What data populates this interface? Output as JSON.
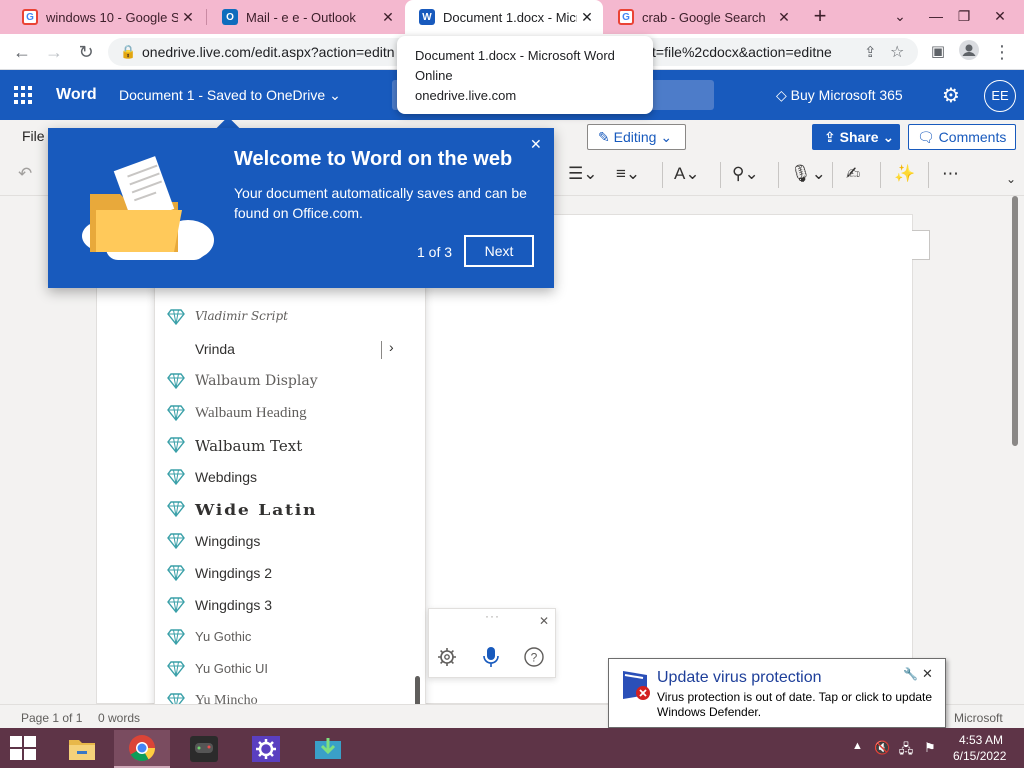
{
  "browser": {
    "tabs": [
      {
        "title": "windows 10 - Google Search",
        "favicon": "google-icon"
      },
      {
        "title": "Mail - e e - Outlook",
        "favicon": "outlook-icon"
      },
      {
        "title": "Document 1.docx - Microsoft Word Online",
        "favicon": "word-icon",
        "active": true
      },
      {
        "title": "crab - Google Search",
        "favicon": "google-icon"
      }
    ],
    "new_tab": "+",
    "url_start": "onedrive.live.com/edit.aspx?action=editn",
    "url_end": "t=file%2cdocx&action=editne",
    "tab_tooltip": {
      "title": "Document 1.docx - Microsoft Word Online",
      "url": "onedrive.live.com"
    }
  },
  "word": {
    "app_name": "Word",
    "doc_title": "Document 1  -  Saved to OneDrive",
    "buy_label": "Buy Microsoft 365",
    "avatar_initials": "EE",
    "file_tab": "File",
    "editing_label": "Editing",
    "share_label": "Share",
    "comments_label": "Comments"
  },
  "callout": {
    "title": "Welcome to Word on the web",
    "body": "Your document automatically saves and can be found on Office.com.",
    "counter": "1 of 3",
    "next_label": "Next"
  },
  "font_list": {
    "items": [
      {
        "name": "Vladimir Script",
        "premium": true
      },
      {
        "name": "Vrinda",
        "premium": false,
        "has_submenu": true
      },
      {
        "name": "Walbaum Display",
        "premium": true
      },
      {
        "name": "Walbaum Heading",
        "premium": true
      },
      {
        "name": "Walbaum Text",
        "premium": true
      },
      {
        "name": "Webdings",
        "premium": true
      },
      {
        "name": "Wide Latin",
        "premium": true
      },
      {
        "name": "Wingdings",
        "premium": true
      },
      {
        "name": "Wingdings 2",
        "premium": true
      },
      {
        "name": "Wingdings 3",
        "premium": true
      },
      {
        "name": "Yu Gothic",
        "premium": true
      },
      {
        "name": "Yu Gothic UI",
        "premium": true
      },
      {
        "name": "Yu Mincho",
        "premium": true
      }
    ]
  },
  "status": {
    "page": "Page 1 of 1",
    "words": "0 words",
    "right": "Microsoft"
  },
  "defender": {
    "title": "Update virus protection",
    "body": "Virus protection is out of date. Tap or click to update Windows Defender."
  },
  "taskbar": {
    "time": "4:53 AM",
    "date": "6/15/2022"
  },
  "colors": {
    "word_blue": "#185abd",
    "chrome_tabstrip": "#f4b8cf",
    "taskbar": "#5e3447"
  }
}
